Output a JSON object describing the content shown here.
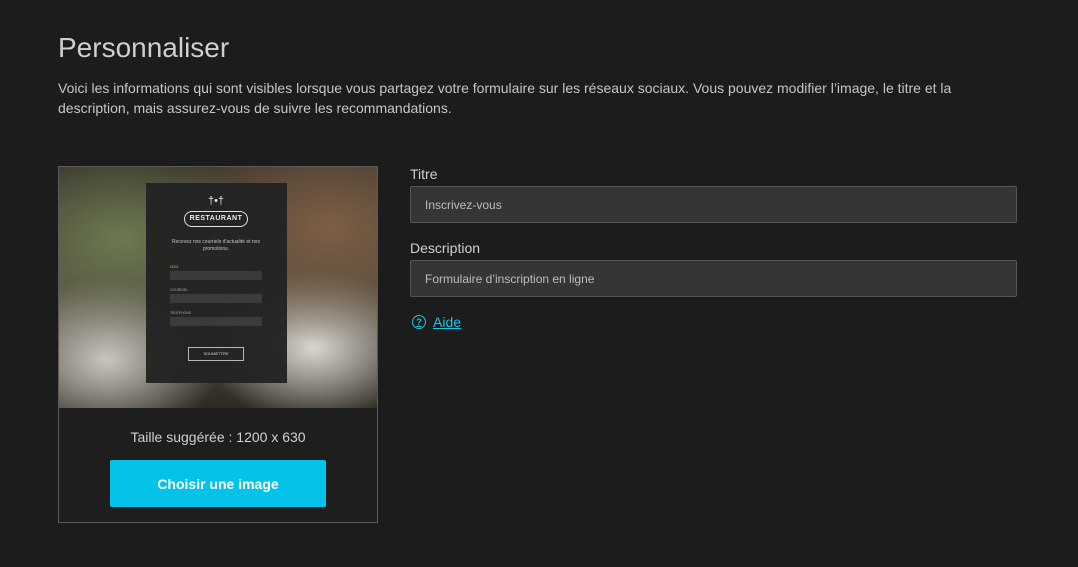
{
  "page": {
    "title": "Personnaliser",
    "description": "Voici les informations qui sont visibles lorsque vous partagez votre formulaire sur les réseaux sociaux. Vous pouvez modifier l’image, le titre et la description, mais assurez-vous de suivre les recommandations."
  },
  "preview": {
    "mock": {
      "logo": "RESTAURANT",
      "text": "Recevez nos courriels d'actualité et nos promotions.",
      "field_1": "NOM",
      "field_2": "COURRIEL",
      "field_3": "TÉLÉPHONE",
      "submit": "SOUMETTRE"
    },
    "size_hint": "Taille suggérée : 1200 x 630",
    "choose_button": "Choisir une image"
  },
  "form": {
    "title_label": "Titre",
    "title_value": "Inscrivez-vous",
    "description_label": "Description",
    "description_value": "Formulaire d’inscription en ligne",
    "help_link": "Aide"
  },
  "colors": {
    "background": "#1c1c1c",
    "accent": "#05c3e8",
    "input_bg": "#353535"
  },
  "icons": {
    "help": "question-circle-icon",
    "cutlery": "cutlery-icon"
  }
}
